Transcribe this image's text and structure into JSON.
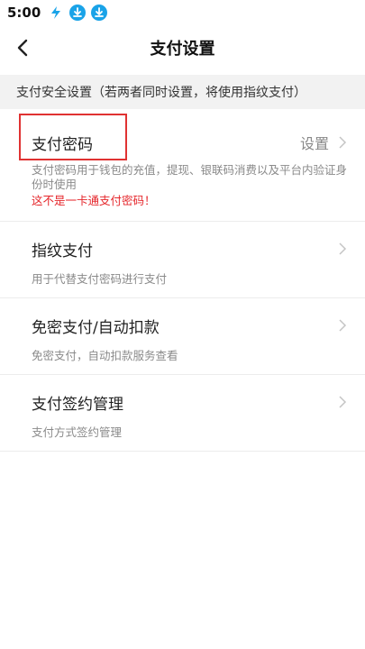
{
  "status_bar": {
    "time": "5:00"
  },
  "nav": {
    "title": "支付设置"
  },
  "section_header": "支付安全设置（若两者同时设置，将使用指纹支付）",
  "rows": [
    {
      "title": "支付密码",
      "value": "设置",
      "desc": "支付密码用于钱包的充值，提现、银联码消费以及平台内验证身份时使用",
      "warning": "这不是一卡通支付密码！"
    },
    {
      "title": "指纹支付",
      "desc": "用于代替支付密码进行支付"
    },
    {
      "title": "免密支付/自动扣款",
      "desc": "免密支付，自动扣款服务查看"
    },
    {
      "title": "支付签约管理",
      "desc": "支付方式签约管理"
    }
  ],
  "colors": {
    "accent_blue": "#1aa3e8",
    "warning_red": "#e5262b",
    "highlight_red": "#e03232"
  }
}
